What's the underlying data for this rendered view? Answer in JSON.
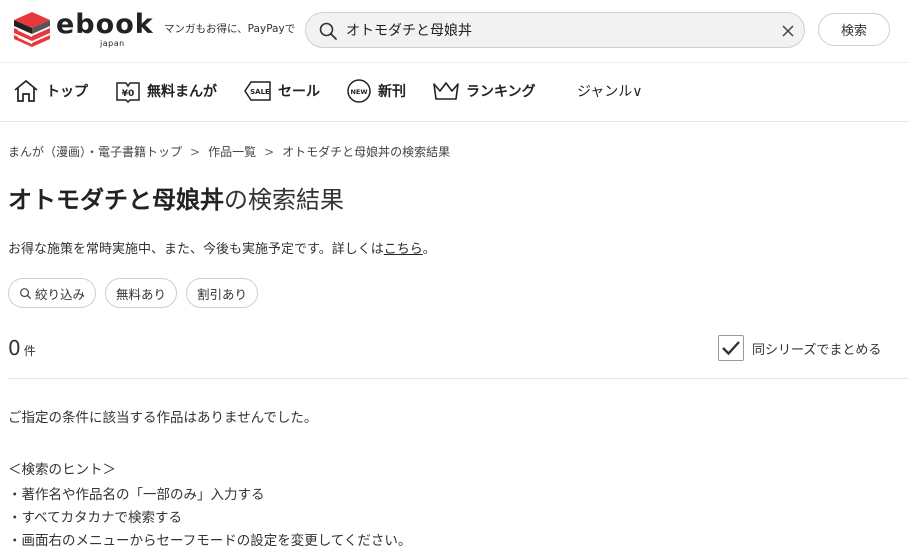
{
  "header": {
    "logo_text": "ebook",
    "logo_sub": "japan",
    "tagline": "マンガもお得に、PayPayで",
    "search": {
      "value": "オトモダチと母娘丼",
      "placeholder": ""
    },
    "search_button": "検索"
  },
  "nav": {
    "items": [
      {
        "label": "トップ",
        "icon": "house-icon"
      },
      {
        "label": "無料まんが",
        "icon": "free-yen-icon"
      },
      {
        "label": "セール",
        "icon": "sale-tag-icon"
      },
      {
        "label": "新刊",
        "icon": "new-badge-icon"
      },
      {
        "label": "ランキング",
        "icon": "crown-icon"
      },
      {
        "label": "ジャンル∨",
        "icon": ""
      }
    ]
  },
  "breadcrumb": {
    "items": [
      "まんが（漫画）・電子書籍トップ",
      "作品一覧",
      "オトモダチと母娘丼の検索結果"
    ],
    "separator": ">"
  },
  "title": {
    "keyword": "オトモダチと母娘丼",
    "suffix": "の検索結果"
  },
  "notice": {
    "text": "お得な施策を常時実施中、また、今後も実施予定です。詳しくは",
    "link": "こちら",
    "end": "。"
  },
  "filters": {
    "narrow": "絞り込み",
    "free": "無料あり",
    "discount": "割引あり"
  },
  "results": {
    "count": "0",
    "unit": "件",
    "series_label": "同シリーズでまとめる",
    "series_checked": true
  },
  "empty": {
    "message": "ご指定の条件に該当する作品はありませんでした。",
    "hint_title": "＜検索のヒント＞",
    "hints": [
      "・著作名や作品名の「一部のみ」入力する",
      "・すべてカタカナで検索する",
      "・画面右のメニューからセーフモードの設定を変更してください。"
    ]
  },
  "colors": {
    "logo_red": "#e8383d",
    "text": "#222222",
    "border": "#cfcfcf"
  }
}
